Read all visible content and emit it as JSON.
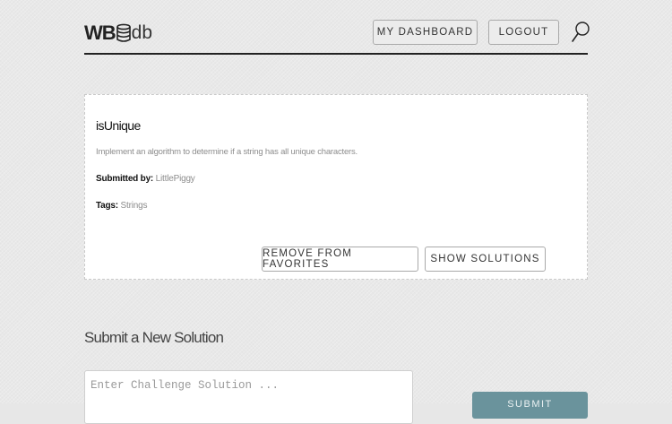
{
  "header": {
    "logo": {
      "left": "WB",
      "right": "db"
    },
    "nav": {
      "dashboard_label": "MY DASHBOARD",
      "logout_label": "LOGOUT"
    },
    "search_icon": "search-icon"
  },
  "challenge": {
    "title": "isUnique",
    "description": "Implement an algorithm to determine if a string has all unique characters.",
    "submitted_label": "Submitted by:",
    "submitted_value": "LittlePiggy",
    "tags_label": "Tags:",
    "tags_value": "Strings",
    "remove_favorites_label": "REMOVE FROM FAVORITES",
    "show_solutions_label": "SHOW SOLUTIONS"
  },
  "submit_section": {
    "title": "Submit a New Solution",
    "input_placeholder": "Enter Challenge Solution ...",
    "submit_label": "SUBMIT"
  },
  "colors": {
    "submit_button": "#6a939c",
    "card_background": "#ffffff",
    "page_background": "#e8e8e8"
  }
}
